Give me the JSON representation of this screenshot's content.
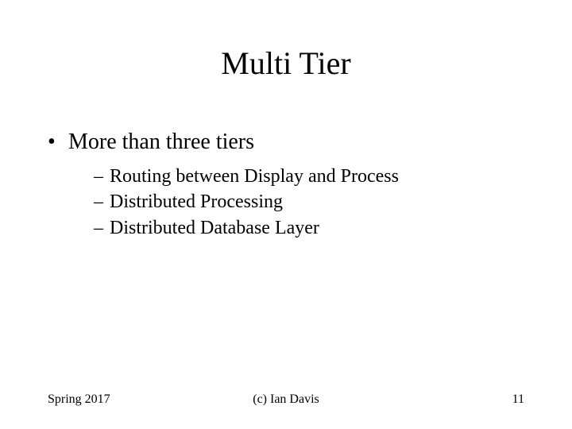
{
  "title": "Multi Tier",
  "bullets": {
    "level1": "More than three tiers",
    "level2": [
      "Routing between Display and Process",
      "Distributed Processing",
      "Distributed Database Layer"
    ]
  },
  "footer": {
    "left": "Spring 2017",
    "center": "(c) Ian Davis",
    "right": "11"
  }
}
